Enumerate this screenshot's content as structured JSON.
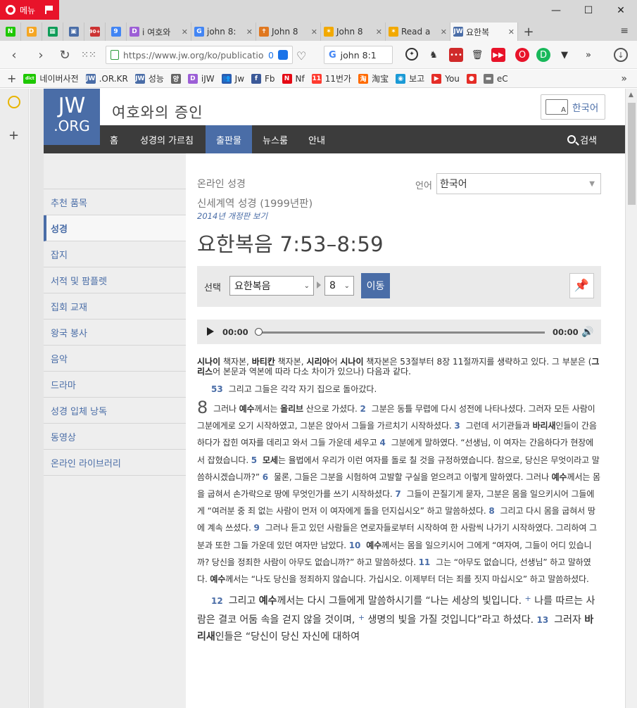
{
  "browser": {
    "menu_label": "메뉴",
    "tabs": [
      {
        "label": "",
        "icon": "naver-icon",
        "color": "#1ec800",
        "glyph": "N"
      },
      {
        "label": "",
        "icon": "d-icon",
        "color": "#f5a623",
        "glyph": "D"
      },
      {
        "label": "",
        "icon": "sheet-icon",
        "color": "#0f9d58",
        "glyph": "▦"
      },
      {
        "label": "",
        "icon": "contact-icon",
        "color": "#4a6da7",
        "glyph": "▣"
      },
      {
        "label": "",
        "icon": "gmail-icon",
        "color": "#c33",
        "glyph": "90+"
      },
      {
        "label": "",
        "icon": "calendar-icon",
        "color": "#4285f4",
        "glyph": "9"
      },
      {
        "label": "i 여호와",
        "icon": "d-icon",
        "color": "#9c5fd6",
        "glyph": "D"
      },
      {
        "label": "john 8:",
        "icon": "google-icon",
        "color": "#4285f4",
        "glyph": "G"
      },
      {
        "label": "John 8",
        "icon": "bible-icon",
        "color": "#e0771f",
        "glyph": "✝"
      },
      {
        "label": "John 8",
        "icon": "sun-icon",
        "color": "#f2a900",
        "glyph": "✶"
      },
      {
        "label": "Read a",
        "icon": "sun-icon",
        "color": "#f2a900",
        "glyph": "✶"
      },
      {
        "label": "요한복",
        "icon": "jw-icon",
        "color": "#4a6da7",
        "glyph": "JW"
      }
    ],
    "url": "https://www.jw.org/ko/publication",
    "url_badge": "0",
    "search_query": "john 8:1",
    "bookmarks": [
      {
        "label": "네이버사전",
        "icon": "naver-dic-icon",
        "color": "#1ec800",
        "glyph": "dict"
      },
      {
        "label": ".OR.KR",
        "icon": "jw-icon",
        "color": "#4a6da7",
        "glyph": "JW"
      },
      {
        "label": "성능",
        "icon": "jw-icon",
        "color": "#4a6da7",
        "glyph": "JW"
      },
      {
        "label": "",
        "icon": "yang-icon",
        "color": "#666",
        "glyph": "양"
      },
      {
        "label": "iJW",
        "icon": "d-icon",
        "color": "#9c5fd6",
        "glyph": "D"
      },
      {
        "label": "Jw",
        "icon": "people-icon",
        "color": "#2a5db0",
        "glyph": "👥"
      },
      {
        "label": "Fb",
        "icon": "facebook-icon",
        "color": "#3b5998",
        "glyph": "f"
      },
      {
        "label": "Nf",
        "icon": "netflix-icon",
        "color": "#e50914",
        "glyph": "N"
      },
      {
        "label": "11번가",
        "icon": "11st-icon",
        "color": "#ff3b30",
        "glyph": "11"
      },
      {
        "label": "淘宝",
        "icon": "taobao-icon",
        "color": "#ff6a00",
        "glyph": "淘"
      },
      {
        "label": "보고",
        "icon": "report-icon",
        "color": "#1a9ad6",
        "glyph": "◉"
      },
      {
        "label": "You",
        "icon": "youtube-icon",
        "color": "#e52d27",
        "glyph": "▶"
      },
      {
        "label": "",
        "icon": "record-icon",
        "color": "#e52d27",
        "glyph": "●"
      },
      {
        "label": "eC",
        "icon": "folder-icon",
        "color": "#777",
        "glyph": "▬"
      }
    ]
  },
  "site": {
    "logo_line1": "JW",
    "logo_line2": ".ORG",
    "title": "여호와의 증인",
    "language_button": "한국어",
    "nav": [
      "홈",
      "성경의 가르침",
      "출판물",
      "뉴스룸",
      "안내"
    ],
    "search_label": "검색",
    "sidebar": [
      "추천 품목",
      "성경",
      "잡지",
      "서적 및 팜플렛",
      "집회 교재",
      "왕국 봉사",
      "음악",
      "드라마",
      "성경 입체 낭독",
      "동영상",
      "온라인 라이브러리"
    ]
  },
  "article": {
    "breadcrumb": "온라인 성경",
    "language_label": "언어",
    "language_value": "한국어",
    "version": "신세계역 성경 (1999년판)",
    "revision_link": "2014년 개정판 보기",
    "heading": "요한복음 7:53–8:59",
    "selector_label": "선택",
    "book_value": "요한복음",
    "chapter_value": "8",
    "go_button": "이동",
    "audio_start": "00:00",
    "audio_end": "00:00",
    "note_p1": "시나이",
    "note_p2": " 책자본, ",
    "note_p3": "바티칸",
    "note_p4": " 책자본, ",
    "note_p5": "시리아",
    "note_p6": "어 ",
    "note_p7": "시나이",
    "note_p8": " 책자본은 53절부터 8장 11절까지를 생략하고 있다. 그 부분은 (",
    "note_p9": "그리스",
    "note_p10": "어 본문과 역본에 따라 다소 차이가 있으나) 다음과 같다.",
    "v53_num": "53",
    "v53_text": "그리고 그들은 각각 자기 집으로 돌아갔다.",
    "chapter_num": "8",
    "v1a": "그러나 ",
    "v1b": "예수",
    "v1c": "께서는 ",
    "v1d": "올리브",
    "v1e": " 산으로 가셨다.",
    "v2n": "2",
    "v2": "그분은 동틀 무렵에 다시 성전에 나타나셨다. 그러자 모든 사람이 그분에게로 오기 시작하였고, 그분은 앉아서 그들을 가르치기 시작하셨다.",
    "v3n": "3",
    "v3a": "그런데 서기관들과 ",
    "v3b": "바리새",
    "v3c": "인들이 간음하다가 잡힌 여자를 데리고 와서 그들 가운데 세우고",
    "v4n": "4",
    "v4": "그분에게 말하였다. “선생님, 이 여자는 간음하다가 현장에서 잡혔습니다.",
    "v5n": "5",
    "v5a": "모세",
    "v5b": "는 율법에서 우리가 이런 여자를 돌로 칠 것을 규정하였습니다. 참으로, 당신은 무엇이라고 말씀하시겠습니까?”",
    "v6n": "6",
    "v6a": "물론, 그들은 그분을 시험하여 고발할 구실을 얻으려고 이렇게 말하였다. 그러나 ",
    "v6b": "예수",
    "v6c": "께서는 몸을 굽혀서 손가락으로 땅에 무엇인가를 쓰기 시작하셨다.",
    "v7n": "7",
    "v7": "그들이 끈질기게 묻자, 그분은 몸을 일으키시어 그들에게 “여러분 중 죄 없는 사람이 먼저 이 여자에게 돌을 던지십시오” 하고 말씀하셨다.",
    "v8n": "8",
    "v8": "그리고 다시 몸을 굽혀서 땅에 계속 쓰셨다.",
    "v9n": "9",
    "v9": "그러나 듣고 있던 사람들은 연로자들로부터 시작하여 한 사람씩 나가기 시작하였다. 그리하여 그분과 또한 그들 가운데 있던 여자만 남았다.",
    "v10n": "10",
    "v10a": "예수",
    "v10b": "께서는 몸을 일으키시어 그에게 “여자여, 그들이 어디 있습니까? 당신을 정죄한 사람이 아무도 없습니까?” 하고 말씀하셨다.",
    "v11n": "11",
    "v11a": "그는 “아무도 없습니다, 선생님” 하고 말하였다. ",
    "v11b": "예수",
    "v11c": "께서는 “나도 당신을 정죄하지 않습니다. 가십시오. 이제부터 더는 죄를 짓지 마십시오” 하고 말씀하셨다.",
    "v12n": "12",
    "v12a": "그리고 ",
    "v12b": "예수",
    "v12c": "께서는 다시 그들에게 말씀하시기를 “나는 세상의 빛입니다.",
    "v12d": "나를 따르는 사람은 결코 어둠 속을 걷지 않을 것이며,",
    "v12e": "생명의 빛을 가질 것입니다”라고 하셨다.",
    "v13n": "13",
    "v13a": "그러자 ",
    "v13b": "바리새",
    "v13c": "인들은 “당신이 당신 자신에 대하여"
  }
}
